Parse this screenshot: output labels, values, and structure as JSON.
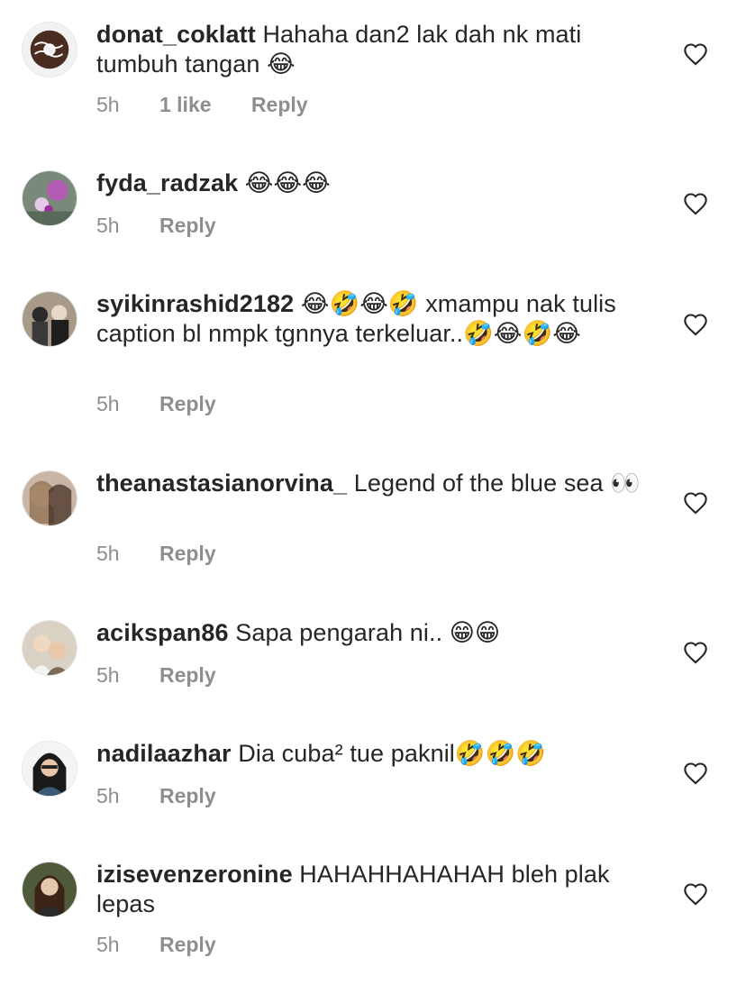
{
  "comments": [
    {
      "username": "donat_coklatt",
      "text": "Hahaha dan2 lak dah nk mati tumbuh tangan 😂",
      "time": "5h",
      "likes": "1 like",
      "reply": "Reply"
    },
    {
      "username": "fyda_radzak",
      "text": "😂😂😂",
      "time": "5h",
      "likes": "",
      "reply": "Reply"
    },
    {
      "username": "syikinrashid2182",
      "text": "😂🤣😂🤣 xmampu nak tulis caption bl nmpk tgnnya terkeluar..🤣😂🤣😂",
      "time": "5h",
      "likes": "",
      "reply": "Reply"
    },
    {
      "username": "theanastasianorvina_",
      "text": "Legend of the blue sea 👀",
      "time": "5h",
      "likes": "",
      "reply": "Reply"
    },
    {
      "username": "acikspan86",
      "text": "Sapa pengarah ni.. 😁😁",
      "time": "5h",
      "likes": "",
      "reply": "Reply"
    },
    {
      "username": "nadilaazhar",
      "text": "Dia cuba² tue paknil🤣🤣🤣",
      "time": "5h",
      "likes": "",
      "reply": "Reply"
    },
    {
      "username": "izisevenzeronine",
      "text": "HAHAHHAHAHAH bleh plak lepas",
      "time": "5h",
      "likes": "",
      "reply": "Reply"
    }
  ],
  "colors": {
    "text": "#262626",
    "meta": "#8e8e8e"
  },
  "icons": {
    "like": "heart-outline-icon"
  }
}
